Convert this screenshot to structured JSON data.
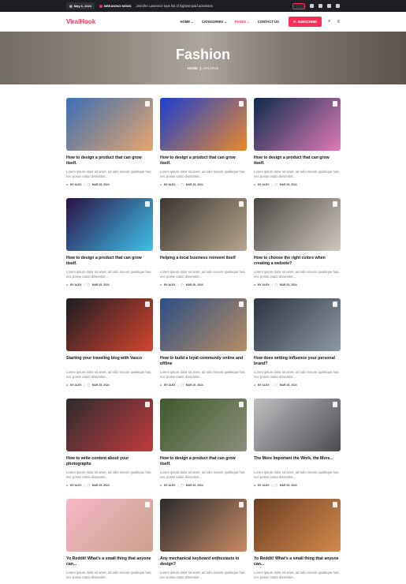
{
  "topbar": {
    "date": "May 6, 2024",
    "breaking_label": "BREAKING NEWS",
    "headline": "Jennifer Lawrence tops list of highest-paid actresses"
  },
  "header": {
    "logo": "ViralHook",
    "nav": [
      "HOME ⌄",
      "CATEGORIES ⌄",
      "PAGES ⌄",
      "CONTACT US"
    ],
    "subscribe": "SUBSCRIBE"
  },
  "hero": {
    "title": "Fashion",
    "crumb_home": "HOME",
    "crumb_sep": "❯",
    "crumb_current": "ARCHIVE"
  },
  "posts": [
    {
      "title": "How to design a product that can grow itself.",
      "excerpt": "Lorem ipsum dolor sit amet, ad odio novum qualisque has, nec posse oratio dissentiet...",
      "author": "BY ALEX",
      "date": "MAR 25, 2024",
      "colors": [
        "#3b6fb5",
        "#e8a56a"
      ]
    },
    {
      "title": "How to design a product that can grow itself.",
      "excerpt": "Lorem ipsum dolor sit amet, ad odio novum qualisque has, nec posse oratio dissentiet...",
      "author": "BY ALEX",
      "date": "MAR 25, 2024",
      "colors": [
        "#1b3fd1",
        "#e88a2b"
      ]
    },
    {
      "title": "How to design a product that can grow itself.",
      "excerpt": "Lorem ipsum dolor sit amet, ad odio novum qualisque has, nec posse oratio dissentiet...",
      "author": "BY ALEX",
      "date": "MAR 25, 2024",
      "colors": [
        "#0d2b4d",
        "#e07ab8"
      ]
    },
    {
      "title": "How to design a product that can grow itself.",
      "excerpt": "Lorem ipsum dolor sit amet, ad odio novum qualisque has, nec posse oratio dissentiet...",
      "author": "BY ALEX",
      "date": "MAR 25, 2024",
      "colors": [
        "#2a1346",
        "#3fc1e8"
      ]
    },
    {
      "title": "Helping a local business reinvent itself",
      "excerpt": "Lorem ipsum dolor sit amet, ad odio novum qualisque has, nec posse oratio dissentiet...",
      "author": "BY ALEX",
      "date": "MAR 25, 2024",
      "colors": [
        "#3a3631",
        "#b8a68c"
      ]
    },
    {
      "title": "How to choose the right colors when creating a website?",
      "excerpt": "Lorem ipsum dolor sit amet, ad odio novum qualisque has, nec posse oratio dissentiet...",
      "author": "BY ALEX",
      "date": "MAR 25, 2024",
      "colors": [
        "#4a4743",
        "#cfc8bd"
      ]
    },
    {
      "title": "Starting your traveling blog with Vasco",
      "excerpt": "Lorem ipsum dolor sit amet, ad odio novum qualisque has, nec posse oratio dissentiet...",
      "author": "BY ALEX",
      "date": "MAR 25, 2024",
      "colors": [
        "#1d1d22",
        "#d6452f"
      ]
    },
    {
      "title": "How to build a loyal community online and offline",
      "excerpt": "Lorem ipsum dolor sit amet, ad odio novum qualisque has, nec posse oratio dissentiet...",
      "author": "BY ALEX",
      "date": "MAR 25, 2024",
      "colors": [
        "#2b4f86",
        "#b98c62"
      ]
    },
    {
      "title": "How does writing influence your personal brand?",
      "excerpt": "Lorem ipsum dolor sit amet, ad odio novum qualisque has, nec posse oratio dissentiet...",
      "author": "BY ALEX",
      "date": "MAR 25, 2024",
      "colors": [
        "#2b3440",
        "#8d99a5"
      ]
    },
    {
      "title": "How to write content about your photographs",
      "excerpt": "Lorem ipsum dolor sit amet, ad odio novum qualisque has, nec posse oratio dissentiet...",
      "author": "BY ALEX",
      "date": "MAR 25, 2024",
      "colors": [
        "#2c2c2e",
        "#c23b3b"
      ]
    },
    {
      "title": "How to design a product that can grow itself.",
      "excerpt": "Lorem ipsum dolor sit amet, ad odio novum qualisque has, nec posse oratio dissentiet...",
      "author": "BY ALEX",
      "date": "MAR 25, 2024",
      "colors": [
        "#3e5a2a",
        "#8b8f7a"
      ]
    },
    {
      "title": "The More Important the Work, the More...",
      "excerpt": "Lorem ipsum dolor sit amet, ad odio novum qualisque has, nec posse oratio dissentiet...",
      "author": "BY ALEX",
      "date": "MAR 25, 2024",
      "colors": [
        "#bdbfc1",
        "#4a4c50"
      ]
    },
    {
      "title": "Yo Reddit! What’s a small thing that anyone can...",
      "excerpt": "Lorem ipsum dolor sit amet, ad odio novum qualisque has, nec posse oratio dissentiet...",
      "author": "BY ALEX",
      "date": "MAR 25, 2024",
      "colors": [
        "#f6b7c8",
        "#c9a38a"
      ]
    },
    {
      "title": "Any mechanical keyboard enthusiasts in design?",
      "excerpt": "Lorem ipsum dolor sit amet, ad odio novum qualisque has, nec posse oratio dissentiet...",
      "author": "BY ALEX",
      "date": "MAR 25, 2024",
      "colors": [
        "#2a2a2d",
        "#c98b62"
      ]
    },
    {
      "title": "Yo Reddit! What’s a small thing that anyone can...",
      "excerpt": "Lorem ipsum dolor sit amet, ad odio novum qualisque has, nec posse oratio dissentiet...",
      "author": "BY ALEX",
      "date": "MAR 25, 2024",
      "colors": [
        "#6a3f24",
        "#d48a4c"
      ]
    }
  ]
}
